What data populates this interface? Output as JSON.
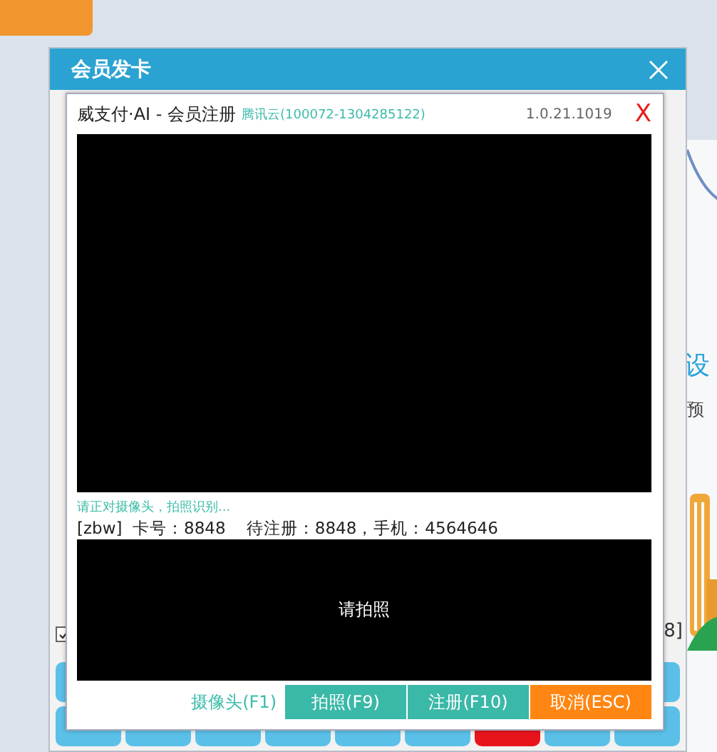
{
  "background": {
    "heading_fragment": "设",
    "text_fragment": "预",
    "shortcut_fragment": "8]",
    "checkbox": {
      "checked": true
    }
  },
  "outer_dialog": {
    "title": "会员发卡"
  },
  "bottom_tiles": [
    {
      "color": "#5bc0e8"
    },
    {
      "color": "#5bc0e8"
    },
    {
      "color": "#5bc0e8"
    },
    {
      "color": "#5bc0e8"
    },
    {
      "color": "#5bc0e8"
    },
    {
      "color": "#5bc0e8"
    },
    {
      "color": "#e8141c"
    },
    {
      "color": "#5bc0e8"
    },
    {
      "color": "#5bc0e8"
    }
  ],
  "dialog": {
    "title": "威支付·AI - 会员注册",
    "provider": "腾讯云(100072-1304285122)",
    "version": "1.0.21.1019",
    "close": "X",
    "hint": "请正对摄像头，拍照识别...",
    "info": "[zbw]  卡号：8848    待注册：8848，手机：4564646",
    "photo_placeholder": "请拍照",
    "camera_link": "摄像头(F1)",
    "buttons": [
      {
        "label": "拍照(F9)",
        "kind": "primary"
      },
      {
        "label": "注册(F10)",
        "kind": "primary"
      },
      {
        "label": "取消(ESC)",
        "kind": "cancel"
      }
    ]
  }
}
